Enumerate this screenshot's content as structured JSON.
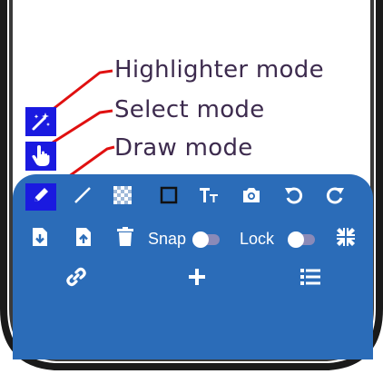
{
  "annotations": {
    "highlighter": "Highlighter mode",
    "select": "Select mode",
    "draw": "Draw mode"
  },
  "modes": [
    {
      "name": "highlighter",
      "icon": "magic-wand-icon"
    },
    {
      "name": "select",
      "icon": "hand-pointer-icon"
    },
    {
      "name": "draw",
      "icon": "pencil-icon",
      "active": true
    }
  ],
  "toolbar": {
    "row1": [
      "pencil-icon",
      "line-icon",
      "checkerboard-icon",
      "rectangle-icon",
      "text-size-icon",
      "camera-icon",
      "undo-icon",
      "redo-icon"
    ],
    "row2": {
      "icons": [
        "file-download-icon",
        "file-upload-icon",
        "trash-icon"
      ],
      "snap_label": "Snap",
      "lock_label": "Lock",
      "end_icon": "compress-icon"
    },
    "row3": [
      "link-icon",
      "plus-icon",
      "list-icon"
    ]
  },
  "colors": {
    "panel": "#2b6cb8",
    "mode_button": "#1a1ae0",
    "callout_line": "#e01010",
    "label_text": "#3d2b4e"
  }
}
